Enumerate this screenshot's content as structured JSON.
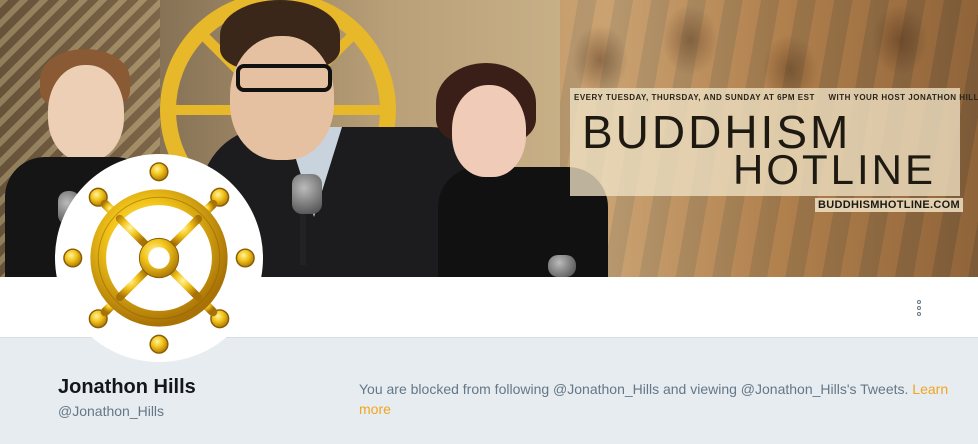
{
  "banner": {
    "schedule_text": "EVERY TUESDAY, THURSDAY, AND SUNDAY AT 6PM EST",
    "host_text": "WITH YOUR HOST JONATHON HILLS",
    "title_line1": "BUDDHISM",
    "title_line2": "HOTLINE",
    "url": "BUDDHISMHOTLINE.COM"
  },
  "avatar": {
    "icon": "dharma-wheel-icon"
  },
  "nav": {
    "more_icon": "more-options-icon"
  },
  "profile": {
    "name": "Jonathon Hills",
    "handle": "@Jonathon_Hills"
  },
  "blocked": {
    "message": "You are blocked from following @Jonathon_Hills and viewing @Jonathon_Hills's Tweets. ",
    "link_label": "Learn more"
  },
  "colors": {
    "accent": "#f2a51f",
    "muted_text": "#657786",
    "background": "#e6ecf0"
  }
}
